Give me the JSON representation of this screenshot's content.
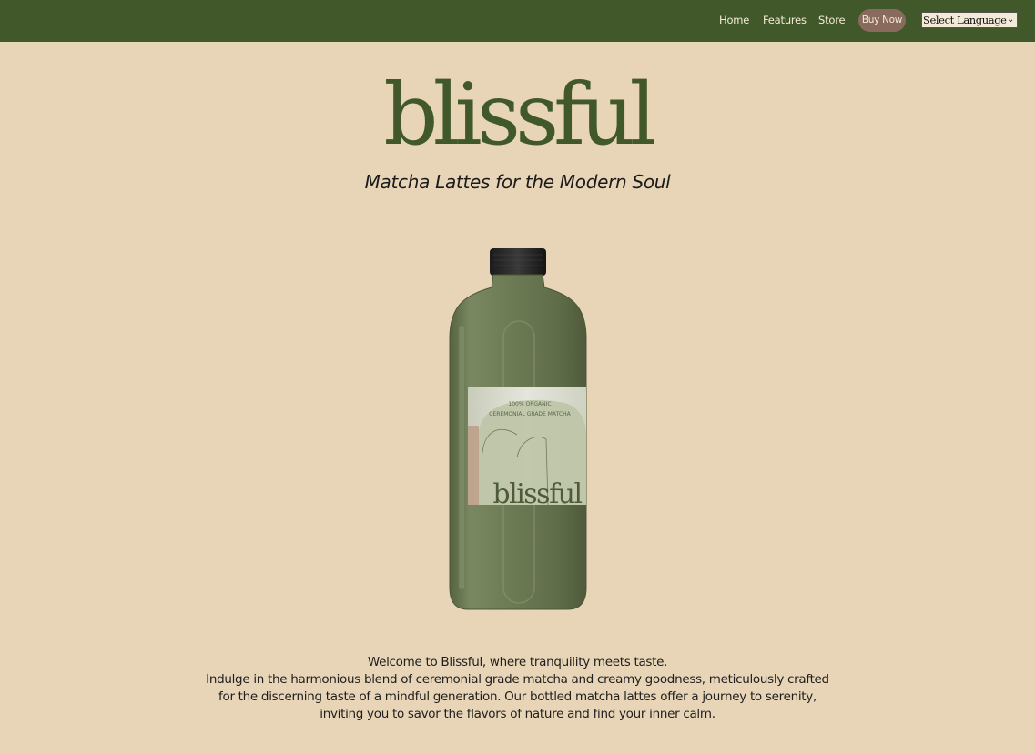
{
  "nav": {
    "home": "Home",
    "features": "Features",
    "store": "Store",
    "buy_now": "Buy Now",
    "language_select": "Select Language"
  },
  "hero": {
    "brand": "blissful",
    "tagline": "Matcha Lattes for the Modern Soul"
  },
  "product": {
    "label_text_line1": "100% ORGANIC",
    "label_text_line2": "CEREMONIAL GRADE MATCHA",
    "label_brand": "blissful"
  },
  "intro": {
    "line1": "Welcome to Blissful, where tranquility meets taste.",
    "line2": "Indulge in the harmonious blend of ceremonial grade matcha and creamy goodness, meticulously crafted",
    "line3": "for the discerning taste of a mindful generation. Our bottled matcha lattes offer a journey to serenity,",
    "line4": "inviting you to savor the flavors of nature and find your inner calm."
  },
  "colors": {
    "background": "#e8d5b7",
    "nav_green": "#41592a",
    "buy_button": "#8a6a5c",
    "bottle_green": "#6e7d57"
  },
  "icons": [
    "chevron-down-icon"
  ]
}
